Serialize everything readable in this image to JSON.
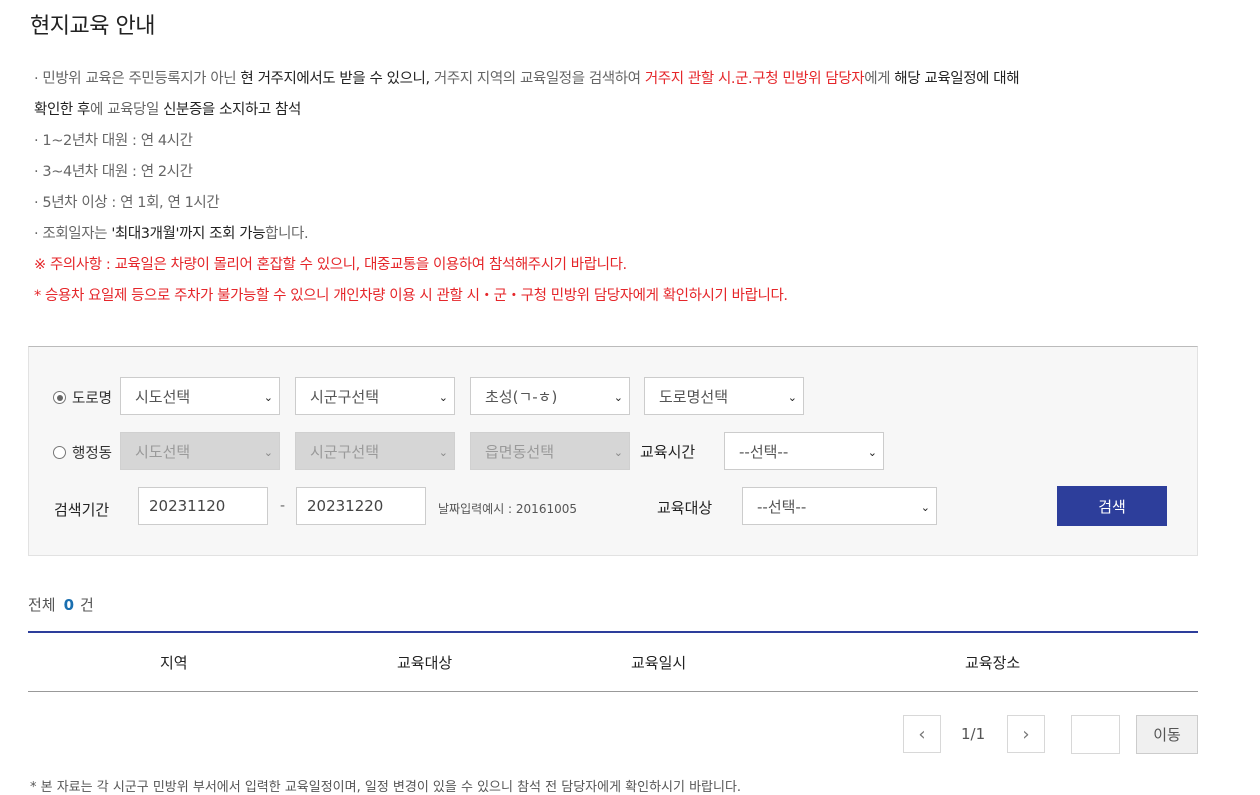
{
  "page": {
    "title": "현지교육 안내"
  },
  "notice": {
    "l1a": "· 민방위 교육은 주민등록지가 아닌 ",
    "l1b": "현 거주지에서도 받을 수 있으니,",
    "l1c": " 거주지 지역의 교육일정을 검색하여 ",
    "l1d": "거주지 관할 시.군.구청 민방위 담당자",
    "l1e": "에게 ",
    "l1f": "해당 교육일정에 대해",
    "l2a": "확인한 후",
    "l2b": "에 교육당일 ",
    "l2c": "신분증을 소지하고 참석",
    "l3": "· 1~2년차 대원 : 연 4시간",
    "l4": "· 3~4년차 대원 : 연 2시간",
    "l5": "· 5년차 이상 : 연 1회, 연 1시간",
    "l6a": "· 조회일자는 ",
    "l6b": "'최대3개월'까지 조회 가능",
    "l6c": "합니다.",
    "l7": "※ 주의사항 : 교육일은 차량이 몰리어 혼잡할 수 있으니, 대중교통을 이용하여 참석해주시기 바랍니다.",
    "l8": "* 승용차 요일제 등으로 주차가 불가능할 수 있으니 개인차량 이용 시 관할 시・군・구청 민방위 담당자에게 확인하시기 바랍니다."
  },
  "search": {
    "road_label": "도로명",
    "admin_label": "행정동",
    "road": {
      "sido": "시도선택",
      "sigungu": "시군구선택",
      "initial": "초성(ㄱ-ㅎ)",
      "roadname": "도로명선택"
    },
    "admin": {
      "sido": "시도선택",
      "sigungu": "시군구선택",
      "eupmyeondong": "읍면동선택"
    },
    "edu_time_label": "교육시간",
    "edu_time_value": "--선택--",
    "period_label": "검색기간",
    "date_from": "20231120",
    "date_sep": "-",
    "date_to": "20231220",
    "date_hint": "날짜입력예시 : 20161005",
    "target_label": "교육대상",
    "target_value": "--선택--",
    "button": "검색",
    "arrow": "⌄"
  },
  "results": {
    "total_label": "전체",
    "total_count": "0",
    "total_unit": "건",
    "columns": [
      "지역",
      "교육대상",
      "교육일시",
      "교육장소"
    ]
  },
  "pagination": {
    "prev": "‹",
    "next": "›",
    "info": "1/1",
    "go": "이동"
  },
  "footnote": "* 본 자료는 각 시군구 민방위 부서에서 입력한 교육일정이며, 일정 변경이 있을 수 있으니 참석 전 담당자에게 확인하시기 바랍니다."
}
